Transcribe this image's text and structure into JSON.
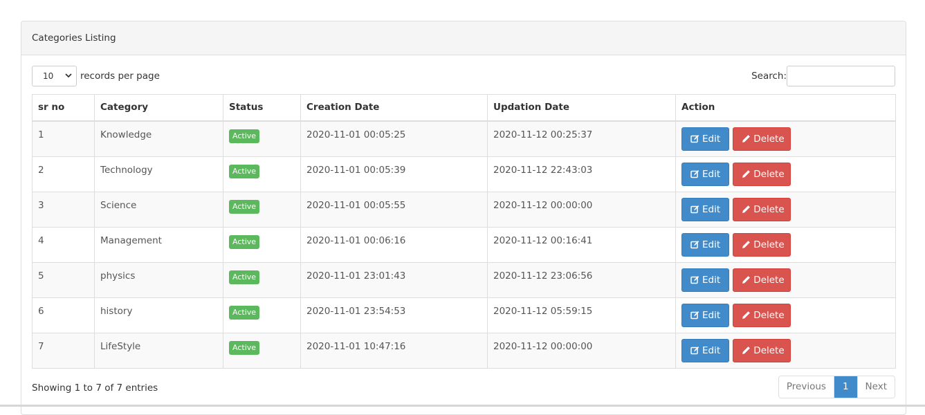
{
  "panel": {
    "title": "Categories Listing"
  },
  "controls": {
    "length_value": "10",
    "length_label": "records per page",
    "search_label": "Search:",
    "search_value": "",
    "search_placeholder": ""
  },
  "table": {
    "columns": [
      "sr no",
      "Category",
      "Status",
      "Creation Date",
      "Updation Date",
      "Action"
    ],
    "rows": [
      {
        "sr": "1",
        "category": "Knowledge",
        "status": "Active",
        "created": "2020-11-01 00:05:25",
        "updated": "2020-11-12 00:25:37"
      },
      {
        "sr": "2",
        "category": "Technology",
        "status": "Active",
        "created": "2020-11-01 00:05:39",
        "updated": "2020-11-12 22:43:03"
      },
      {
        "sr": "3",
        "category": "Science",
        "status": "Active",
        "created": "2020-11-01 00:05:55",
        "updated": "2020-11-12 00:00:00"
      },
      {
        "sr": "4",
        "category": "Management",
        "status": "Active",
        "created": "2020-11-01 00:06:16",
        "updated": "2020-11-12 00:16:41"
      },
      {
        "sr": "5",
        "category": "physics",
        "status": "Active",
        "created": "2020-11-01 23:01:43",
        "updated": "2020-11-12 23:06:56"
      },
      {
        "sr": "6",
        "category": "history",
        "status": "Active",
        "created": "2020-11-01 23:54:53",
        "updated": "2020-11-12 05:59:15"
      },
      {
        "sr": "7",
        "category": "LifeStyle",
        "status": "Active",
        "created": "2020-11-01 10:47:16",
        "updated": "2020-11-12 00:00:00"
      }
    ],
    "actions": {
      "edit_label": "Edit",
      "edit_icon": "edit-icon",
      "delete_label": "Delete",
      "delete_icon": "pencil-icon"
    }
  },
  "footer": {
    "info": "Showing 1 to 7 of 7 entries",
    "pagination": {
      "previous": "Previous",
      "current": "1",
      "next": "Next"
    }
  },
  "colors": {
    "primary": "#428bca",
    "danger": "#d9534f",
    "success": "#5cb85c"
  }
}
